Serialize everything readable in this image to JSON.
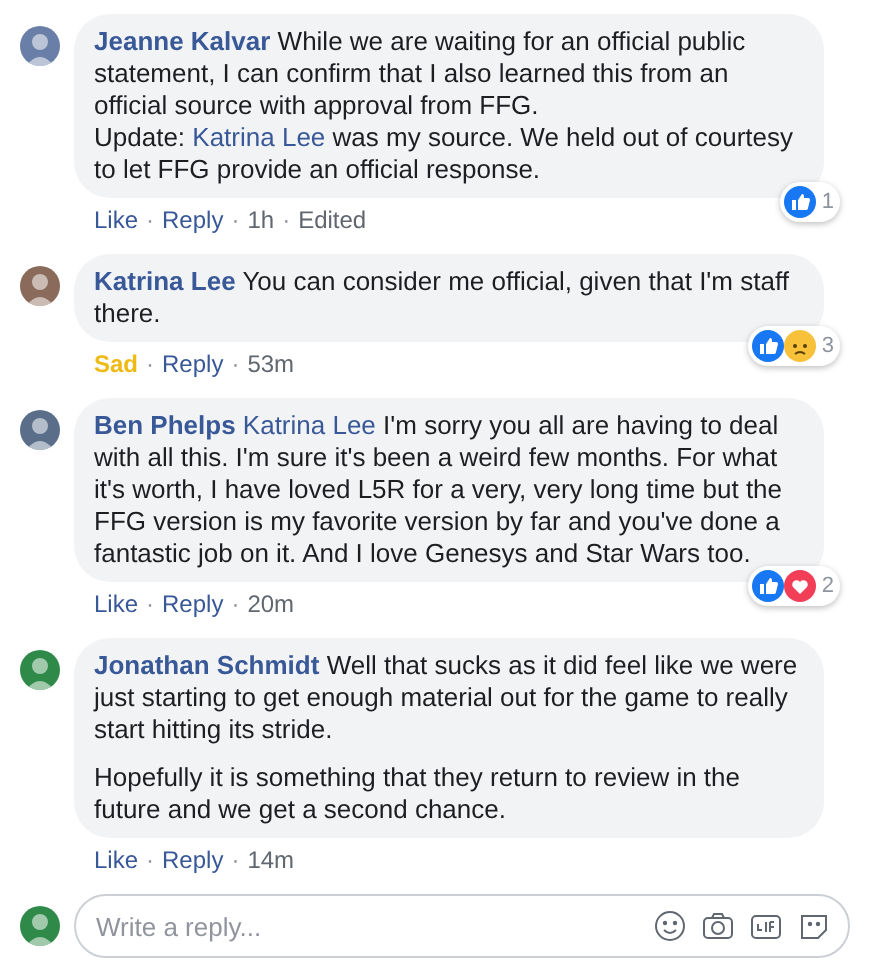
{
  "comments": [
    {
      "author": "Jeanne Kalvar",
      "paragraphs": [
        {
          "lines": [
            [
              {
                "kind": "text",
                "text": "While we are waiting for an official public statement, I can confirm that I also learned this from an official source with approval from FFG."
              }
            ],
            [
              {
                "kind": "text",
                "text": "Update: "
              },
              {
                "kind": "link",
                "text": "Katrina Lee"
              },
              {
                "kind": "text",
                "text": " was my source. We held out of courtesy to let FFG provide an official response."
              }
            ]
          ]
        }
      ],
      "actions": [
        {
          "kind": "react",
          "text": "Like",
          "color": "#385898"
        },
        {
          "kind": "separator",
          "text": "·"
        },
        {
          "kind": "reply",
          "text": "Reply"
        },
        {
          "kind": "separator",
          "text": "·"
        },
        {
          "kind": "time",
          "text": "1h"
        },
        {
          "kind": "separator",
          "text": "·"
        },
        {
          "kind": "edited",
          "text": "Edited"
        }
      ],
      "reactions": [
        {
          "kind": "like"
        }
      ],
      "reaction_count": "1"
    },
    {
      "author": "Katrina Lee",
      "paragraphs": [
        {
          "lines": [
            [
              {
                "kind": "text",
                "text": "You can consider me official, given that I'm staff there."
              }
            ]
          ]
        }
      ],
      "actions": [
        {
          "kind": "react",
          "text": "Sad",
          "color": "#f0ba15"
        },
        {
          "kind": "separator",
          "text": "·"
        },
        {
          "kind": "reply",
          "text": "Reply"
        },
        {
          "kind": "separator",
          "text": "·"
        },
        {
          "kind": "time",
          "text": "53m"
        }
      ],
      "reactions": [
        {
          "kind": "like"
        },
        {
          "kind": "sad"
        }
      ],
      "reaction_count": "3"
    },
    {
      "author": "Ben Phelps",
      "paragraphs": [
        {
          "lines": [
            [
              {
                "kind": "link",
                "text": "Katrina Lee"
              },
              {
                "kind": "text",
                "text": " I'm sorry you all are having to deal with all this. I'm sure it's been a weird few months. For what it's worth, I have loved L5R for a very, very long time but the FFG version is my favorite version by far and you've done a fantastic job on it. And I love Genesys and Star Wars too."
              }
            ]
          ]
        }
      ],
      "actions": [
        {
          "kind": "react",
          "text": "Like",
          "color": "#385898"
        },
        {
          "kind": "separator",
          "text": "·"
        },
        {
          "kind": "reply",
          "text": "Reply"
        },
        {
          "kind": "separator",
          "text": "·"
        },
        {
          "kind": "time",
          "text": "20m"
        }
      ],
      "reactions": [
        {
          "kind": "like"
        },
        {
          "kind": "love"
        }
      ],
      "reaction_count": "2"
    },
    {
      "author": "Jonathan Schmidt",
      "paragraphs": [
        {
          "lines": [
            [
              {
                "kind": "text",
                "text": "Well that sucks as it did feel like we were just starting to get enough material out for the game to really start hitting its stride."
              }
            ]
          ]
        },
        {
          "lines": [
            [
              {
                "kind": "text",
                "text": "Hopefully it is something that they return to review in the future and we get a second chance."
              }
            ]
          ]
        }
      ],
      "actions": [
        {
          "kind": "react",
          "text": "Like",
          "color": "#385898"
        },
        {
          "kind": "separator",
          "text": "·"
        },
        {
          "kind": "reply",
          "text": "Reply"
        },
        {
          "kind": "separator",
          "text": "·"
        },
        {
          "kind": "time",
          "text": "14m"
        }
      ]
    }
  ],
  "reply_box": {
    "placeholder": "Write a reply..."
  }
}
